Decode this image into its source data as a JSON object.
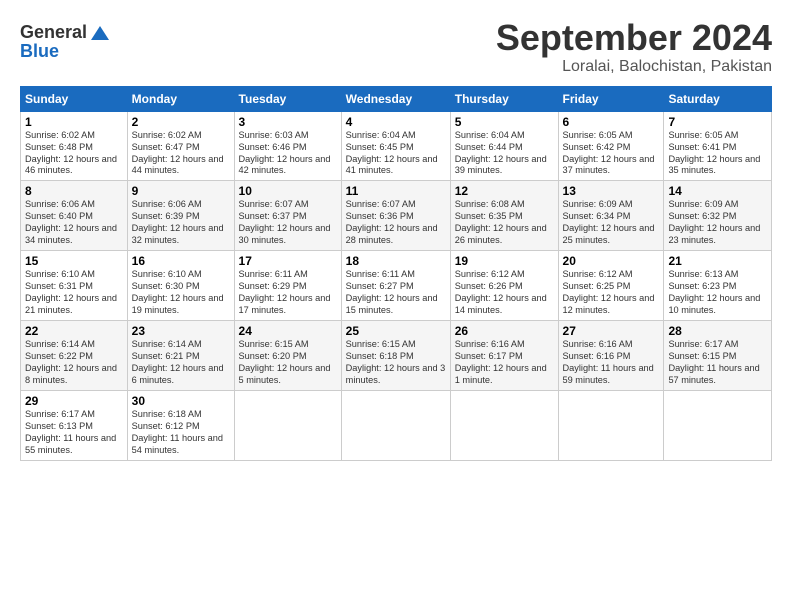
{
  "header": {
    "logo_line1": "General",
    "logo_line2": "Blue",
    "month": "September 2024",
    "location": "Loralai, Balochistan, Pakistan"
  },
  "weekdays": [
    "Sunday",
    "Monday",
    "Tuesday",
    "Wednesday",
    "Thursday",
    "Friday",
    "Saturday"
  ],
  "weeks": [
    [
      {
        "day": "1",
        "sunrise": "Sunrise: 6:02 AM",
        "sunset": "Sunset: 6:48 PM",
        "daylight": "Daylight: 12 hours and 46 minutes."
      },
      {
        "day": "2",
        "sunrise": "Sunrise: 6:02 AM",
        "sunset": "Sunset: 6:47 PM",
        "daylight": "Daylight: 12 hours and 44 minutes."
      },
      {
        "day": "3",
        "sunrise": "Sunrise: 6:03 AM",
        "sunset": "Sunset: 6:46 PM",
        "daylight": "Daylight: 12 hours and 42 minutes."
      },
      {
        "day": "4",
        "sunrise": "Sunrise: 6:04 AM",
        "sunset": "Sunset: 6:45 PM",
        "daylight": "Daylight: 12 hours and 41 minutes."
      },
      {
        "day": "5",
        "sunrise": "Sunrise: 6:04 AM",
        "sunset": "Sunset: 6:44 PM",
        "daylight": "Daylight: 12 hours and 39 minutes."
      },
      {
        "day": "6",
        "sunrise": "Sunrise: 6:05 AM",
        "sunset": "Sunset: 6:42 PM",
        "daylight": "Daylight: 12 hours and 37 minutes."
      },
      {
        "day": "7",
        "sunrise": "Sunrise: 6:05 AM",
        "sunset": "Sunset: 6:41 PM",
        "daylight": "Daylight: 12 hours and 35 minutes."
      }
    ],
    [
      {
        "day": "8",
        "sunrise": "Sunrise: 6:06 AM",
        "sunset": "Sunset: 6:40 PM",
        "daylight": "Daylight: 12 hours and 34 minutes."
      },
      {
        "day": "9",
        "sunrise": "Sunrise: 6:06 AM",
        "sunset": "Sunset: 6:39 PM",
        "daylight": "Daylight: 12 hours and 32 minutes."
      },
      {
        "day": "10",
        "sunrise": "Sunrise: 6:07 AM",
        "sunset": "Sunset: 6:37 PM",
        "daylight": "Daylight: 12 hours and 30 minutes."
      },
      {
        "day": "11",
        "sunrise": "Sunrise: 6:07 AM",
        "sunset": "Sunset: 6:36 PM",
        "daylight": "Daylight: 12 hours and 28 minutes."
      },
      {
        "day": "12",
        "sunrise": "Sunrise: 6:08 AM",
        "sunset": "Sunset: 6:35 PM",
        "daylight": "Daylight: 12 hours and 26 minutes."
      },
      {
        "day": "13",
        "sunrise": "Sunrise: 6:09 AM",
        "sunset": "Sunset: 6:34 PM",
        "daylight": "Daylight: 12 hours and 25 minutes."
      },
      {
        "day": "14",
        "sunrise": "Sunrise: 6:09 AM",
        "sunset": "Sunset: 6:32 PM",
        "daylight": "Daylight: 12 hours and 23 minutes."
      }
    ],
    [
      {
        "day": "15",
        "sunrise": "Sunrise: 6:10 AM",
        "sunset": "Sunset: 6:31 PM",
        "daylight": "Daylight: 12 hours and 21 minutes."
      },
      {
        "day": "16",
        "sunrise": "Sunrise: 6:10 AM",
        "sunset": "Sunset: 6:30 PM",
        "daylight": "Daylight: 12 hours and 19 minutes."
      },
      {
        "day": "17",
        "sunrise": "Sunrise: 6:11 AM",
        "sunset": "Sunset: 6:29 PM",
        "daylight": "Daylight: 12 hours and 17 minutes."
      },
      {
        "day": "18",
        "sunrise": "Sunrise: 6:11 AM",
        "sunset": "Sunset: 6:27 PM",
        "daylight": "Daylight: 12 hours and 15 minutes."
      },
      {
        "day": "19",
        "sunrise": "Sunrise: 6:12 AM",
        "sunset": "Sunset: 6:26 PM",
        "daylight": "Daylight: 12 hours and 14 minutes."
      },
      {
        "day": "20",
        "sunrise": "Sunrise: 6:12 AM",
        "sunset": "Sunset: 6:25 PM",
        "daylight": "Daylight: 12 hours and 12 minutes."
      },
      {
        "day": "21",
        "sunrise": "Sunrise: 6:13 AM",
        "sunset": "Sunset: 6:23 PM",
        "daylight": "Daylight: 12 hours and 10 minutes."
      }
    ],
    [
      {
        "day": "22",
        "sunrise": "Sunrise: 6:14 AM",
        "sunset": "Sunset: 6:22 PM",
        "daylight": "Daylight: 12 hours and 8 minutes."
      },
      {
        "day": "23",
        "sunrise": "Sunrise: 6:14 AM",
        "sunset": "Sunset: 6:21 PM",
        "daylight": "Daylight: 12 hours and 6 minutes."
      },
      {
        "day": "24",
        "sunrise": "Sunrise: 6:15 AM",
        "sunset": "Sunset: 6:20 PM",
        "daylight": "Daylight: 12 hours and 5 minutes."
      },
      {
        "day": "25",
        "sunrise": "Sunrise: 6:15 AM",
        "sunset": "Sunset: 6:18 PM",
        "daylight": "Daylight: 12 hours and 3 minutes."
      },
      {
        "day": "26",
        "sunrise": "Sunrise: 6:16 AM",
        "sunset": "Sunset: 6:17 PM",
        "daylight": "Daylight: 12 hours and 1 minute."
      },
      {
        "day": "27",
        "sunrise": "Sunrise: 6:16 AM",
        "sunset": "Sunset: 6:16 PM",
        "daylight": "Daylight: 11 hours and 59 minutes."
      },
      {
        "day": "28",
        "sunrise": "Sunrise: 6:17 AM",
        "sunset": "Sunset: 6:15 PM",
        "daylight": "Daylight: 11 hours and 57 minutes."
      }
    ],
    [
      {
        "day": "29",
        "sunrise": "Sunrise: 6:17 AM",
        "sunset": "Sunset: 6:13 PM",
        "daylight": "Daylight: 11 hours and 55 minutes."
      },
      {
        "day": "30",
        "sunrise": "Sunrise: 6:18 AM",
        "sunset": "Sunset: 6:12 PM",
        "daylight": "Daylight: 11 hours and 54 minutes."
      },
      null,
      null,
      null,
      null,
      null
    ]
  ]
}
